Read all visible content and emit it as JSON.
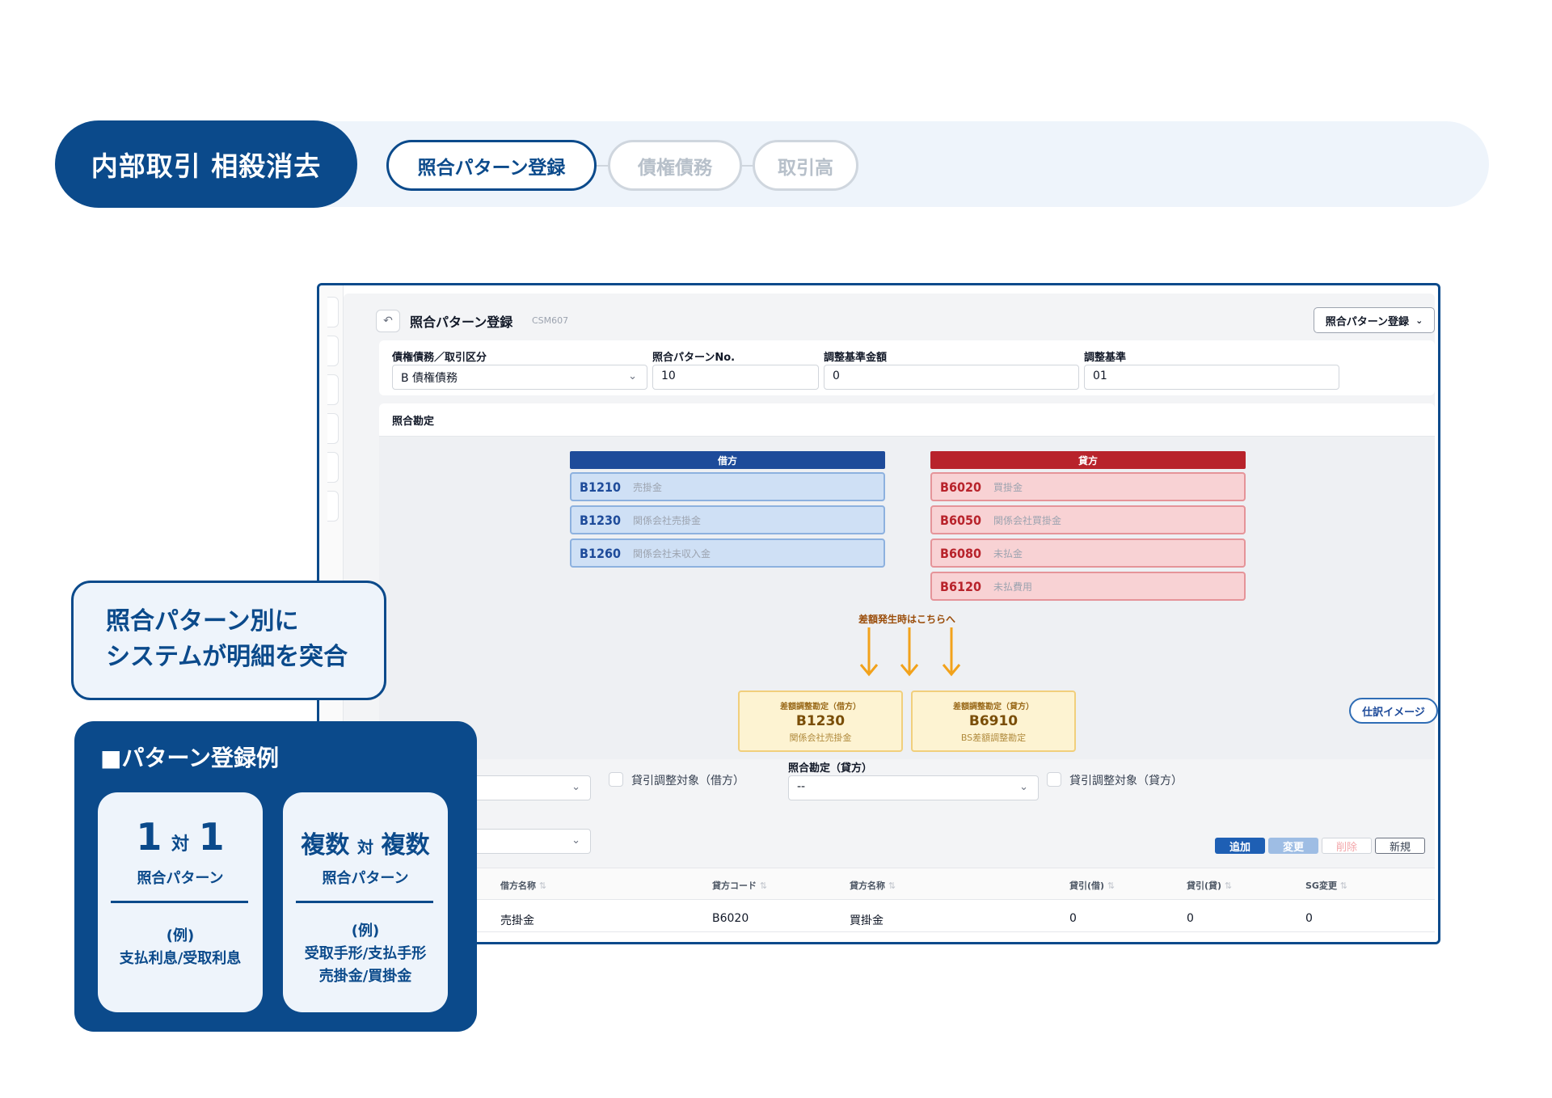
{
  "banner": {
    "title": "内部取引 相殺消去",
    "steps": [
      "照合パターン登録",
      "債権債務",
      "取引高"
    ]
  },
  "screen": {
    "title": "照合パターン登録",
    "code": "CSM607",
    "back_icon": "undo-icon",
    "mode_select": "照合パターン登録"
  },
  "filters": {
    "category_label": "債権債務／取引区分",
    "category_value": "B 債権債務",
    "pattern_no_label": "照合パターンNo.",
    "pattern_no_value": "10",
    "base_amount_label": "調整基準金額",
    "base_amount_value": "0",
    "base_label": "調整基準",
    "base_value": "01"
  },
  "match": {
    "title": "照合勘定",
    "debit_header": "借方",
    "credit_header": "貸方",
    "debit_color": "#1e4b9a",
    "credit_color": "#b8232b",
    "debit_accounts": [
      {
        "code": "B1210",
        "name": "売掛金"
      },
      {
        "code": "B1230",
        "name": "関係会社売掛金"
      },
      {
        "code": "B1260",
        "name": "関係会社未収入金"
      }
    ],
    "credit_accounts": [
      {
        "code": "B6020",
        "name": "買掛金"
      },
      {
        "code": "B6050",
        "name": "関係会社買掛金"
      },
      {
        "code": "B6080",
        "name": "未払金"
      },
      {
        "code": "B6120",
        "name": "未払費用"
      }
    ],
    "diff_note": "差額発生時はこちらへ",
    "adjust_debit": {
      "title": "差額調整勘定（借方）",
      "code": "B1230",
      "name": "関係会社売掛金"
    },
    "adjust_credit": {
      "title": "差額調整勘定（貸方）",
      "code": "B6910",
      "name": "BS差額調整勘定"
    },
    "journal_button": "仕訳イメージ"
  },
  "lower": {
    "debit_adjust_check": "貸引調整対象（借方）",
    "credit_account_label": "照合勘定（貸方）",
    "credit_account_value": "--",
    "credit_adjust_check": "貸引調整対象（貸方）",
    "buttons": {
      "add": "追加",
      "change": "変更",
      "delete": "削除",
      "new": "新規"
    }
  },
  "grid": {
    "columns": [
      "借方名称",
      "貸方コード",
      "貸方名称",
      "貸引(借)",
      "貸引(貸)",
      "SG変更"
    ],
    "sort_icon": "sort-icon",
    "rows": [
      [
        "売掛金",
        "B6020",
        "買掛金",
        "0",
        "0",
        "0"
      ]
    ]
  },
  "callout": {
    "line1": "照合パターン別に",
    "line2": "システムが明細を突合"
  },
  "examples": {
    "title": "■パターン登録例",
    "card1": {
      "big_a": "1",
      "vs": "対",
      "big_b": "1",
      "sub": "照合パターン",
      "example_label": "(例)",
      "example_lines": [
        "支払利息/受取利息"
      ]
    },
    "card2": {
      "big_a": "複数",
      "vs": "対",
      "big_b": "複数",
      "sub": "照合パターン",
      "example_label": "(例)",
      "example_lines": [
        "受取手形/支払手形",
        "売掛金/買掛金"
      ]
    }
  }
}
